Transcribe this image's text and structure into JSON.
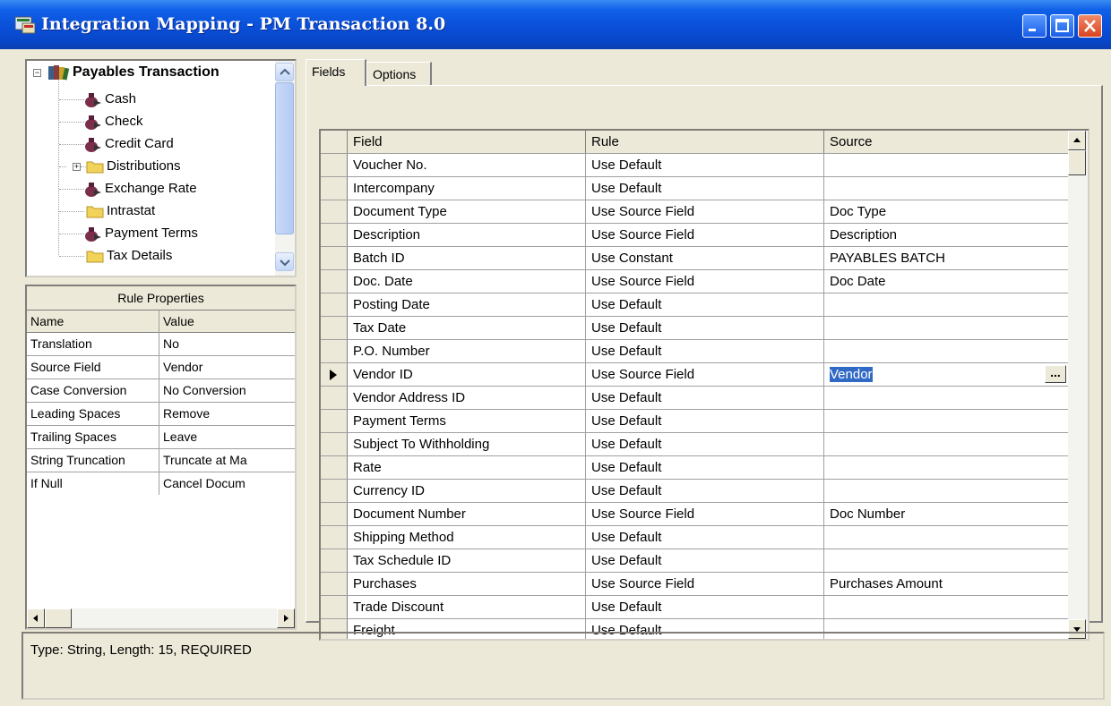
{
  "window": {
    "title": "Integration Mapping - PM Transaction 8.0",
    "controls": [
      "minimize",
      "maximize",
      "close"
    ]
  },
  "tree": {
    "root": {
      "label": "Payables Transaction",
      "icon": "books-icon"
    },
    "items": [
      {
        "label": "Cash",
        "icon": "money-bag-icon"
      },
      {
        "label": "Check",
        "icon": "money-bag-icon"
      },
      {
        "label": "Credit Card",
        "icon": "money-bag-icon"
      },
      {
        "label": "Distributions",
        "icon": "folder-icon"
      },
      {
        "label": "Exchange Rate",
        "icon": "money-bag-icon"
      },
      {
        "label": "Intrastat",
        "icon": "folder-icon"
      },
      {
        "label": "Payment Terms",
        "icon": "money-bag-icon"
      },
      {
        "label": "Tax Details",
        "icon": "folder-icon"
      }
    ]
  },
  "rule_properties": {
    "title": "Rule Properties",
    "columns": [
      "Name",
      "Value"
    ],
    "rows": [
      [
        "Translation",
        "No"
      ],
      [
        "Source Field",
        "Vendor"
      ],
      [
        "Case Conversion",
        "No Conversion"
      ],
      [
        "Leading Spaces",
        "Remove"
      ],
      [
        "Trailing Spaces",
        "Leave"
      ],
      [
        "String Truncation",
        "Truncate at Ma"
      ],
      [
        "If Null",
        "Cancel Docum"
      ]
    ]
  },
  "tabs": [
    "Fields",
    "Options"
  ],
  "fields_grid": {
    "columns": [
      "Field",
      "Rule",
      "Source"
    ],
    "selected_index": 9,
    "rows": [
      [
        "Voucher No.",
        "Use Default",
        ""
      ],
      [
        "Intercompany",
        "Use Default",
        ""
      ],
      [
        "Document Type",
        "Use Source Field",
        "Doc Type"
      ],
      [
        "Description",
        "Use Source Field",
        "Description"
      ],
      [
        "Batch ID",
        "Use Constant",
        "PAYABLES BATCH"
      ],
      [
        "Doc. Date",
        "Use Source Field",
        "Doc Date"
      ],
      [
        "Posting Date",
        "Use Default",
        ""
      ],
      [
        "Tax Date",
        "Use Default",
        ""
      ],
      [
        "P.O. Number",
        "Use Default",
        ""
      ],
      [
        "Vendor ID",
        "Use Source Field",
        "Vendor"
      ],
      [
        "Vendor Address ID",
        "Use Default",
        ""
      ],
      [
        "Payment Terms",
        "Use Default",
        ""
      ],
      [
        "Subject To Withholding",
        "Use Default",
        ""
      ],
      [
        "Rate",
        "Use Default",
        ""
      ],
      [
        "Currency ID",
        "Use Default",
        ""
      ],
      [
        "Document Number",
        "Use Source Field",
        "Doc Number"
      ],
      [
        "Shipping Method",
        "Use Default",
        ""
      ],
      [
        "Tax Schedule ID",
        "Use Default",
        ""
      ],
      [
        "Purchases",
        "Use Source Field",
        "Purchases Amount"
      ],
      [
        "Trade Discount",
        "Use Default",
        ""
      ],
      [
        "Freight",
        "Use Default",
        ""
      ]
    ],
    "ellipsis_label": "..."
  },
  "status": {
    "text": "Type: String, Length: 15, REQUIRED"
  }
}
